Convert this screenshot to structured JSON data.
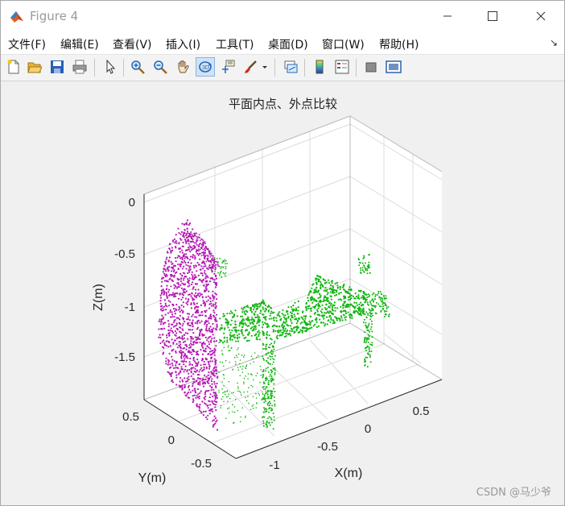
{
  "window": {
    "title": "Figure 4",
    "controls": [
      "minimize",
      "maximize",
      "close"
    ]
  },
  "menu": {
    "items": [
      "文件(F)",
      "编辑(E)",
      "查看(V)",
      "插入(I)",
      "工具(T)",
      "桌面(D)",
      "窗口(W)",
      "帮助(H)"
    ],
    "overflow": "↘"
  },
  "toolbar": {
    "buttons": [
      "new-figure-icon",
      "open-file-icon",
      "save-icon",
      "print-icon",
      "pointer-icon",
      "zoom-in-icon",
      "zoom-out-icon",
      "pan-hand-icon",
      "rotate-3d-icon",
      "data-cursor-icon",
      "brush-icon",
      "brush-dropdown-icon",
      "link-plot-icon",
      "colorbar-icon",
      "legend-icon",
      "hide-plot-tools-icon",
      "show-plot-tools-icon"
    ],
    "active": "rotate-3d-icon"
  },
  "plot": {
    "title": "平面内点、外点比较",
    "xlabel": "X(m)",
    "ylabel": "Y(m)",
    "zlabel": "Z(m)",
    "z_ticks": [
      "0",
      "-0.5",
      "-1",
      "-1.5"
    ],
    "y_ticks": [
      "0.5",
      "0",
      "-0.5"
    ],
    "x_ticks": [
      "-1",
      "-0.5",
      "0",
      "0.5"
    ],
    "colors": {
      "inliers": "#b31ab3",
      "outliers": "#11b511",
      "grid": "#dcdcdc",
      "axes_bg": "#ffffff"
    }
  },
  "chart_data": {
    "type": "scatter",
    "title": "平面内点、外点比较",
    "xlabel": "X(m)",
    "ylabel": "Y(m)",
    "zlabel": "Z(m)",
    "xlim": [
      -1.25,
      0.75
    ],
    "ylim": [
      -0.75,
      0.75
    ],
    "zlim": [
      -2,
      0
    ],
    "grid": true,
    "x_ticks": [
      -1,
      -0.5,
      0,
      0.5
    ],
    "y_ticks": [
      -0.5,
      0,
      0.5
    ],
    "z_ticks": [
      0,
      -0.5,
      -1,
      -1.5
    ],
    "series": []
  },
  "watermark": "CSDN @马少爷"
}
